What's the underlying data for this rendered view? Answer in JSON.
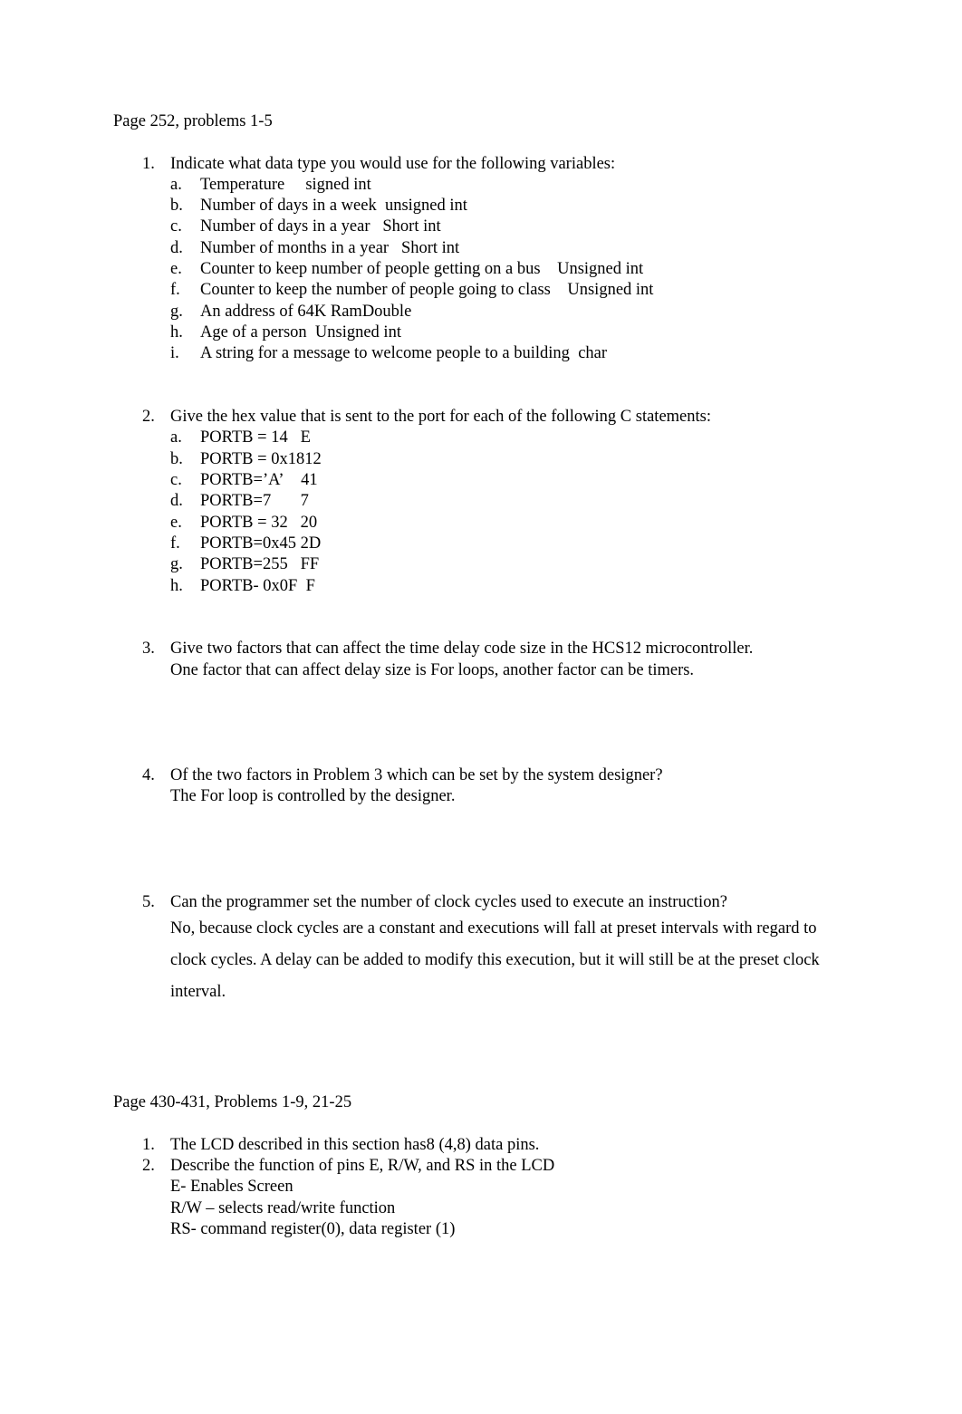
{
  "document": {
    "sections": [
      {
        "heading": "Page 252, problems 1-5",
        "items": [
          {
            "number": "1.",
            "text": "Indicate what data type you would use for the following variables:",
            "subitems": [
              {
                "marker": "a.",
                "text": "Temperature",
                "answer": "     signed int"
              },
              {
                "marker": "b.",
                "text": "Number of days in a week",
                "answer": "  unsigned int"
              },
              {
                "marker": "c.",
                "text": "Number of days in a year",
                "answer": "   Short int"
              },
              {
                "marker": "d.",
                "text": "Number of months in a year",
                "answer": "   Short int"
              },
              {
                "marker": "e.",
                "text": "Counter to keep number of people getting on a bus",
                "answer": "    Unsigned int"
              },
              {
                "marker": "f.",
                "text": "Counter to keep the number of people going to class",
                "answer": "    Unsigned int"
              },
              {
                "marker": "g.",
                "text": "An address of 64K Ram",
                "answer": "Double"
              },
              {
                "marker": "h.",
                "text": "Age of a person",
                "answer": "  Unsigned int"
              },
              {
                "marker": "i.",
                "text": "A string for a message to welcome people to a building",
                "answer": "  char"
              }
            ]
          },
          {
            "number": "2.",
            "text": "Give the hex value that is sent to the port for each of the following C statements:",
            "subitems": [
              {
                "marker": "a.",
                "text": "PORTB = 14",
                "answer": "   E"
              },
              {
                "marker": "b.",
                "text": "PORTB = 0x18",
                "answer": "12"
              },
              {
                "marker": "c.",
                "text": "PORTB=’A’",
                "answer": "    41"
              },
              {
                "marker": "d.",
                "text": "PORTB=7",
                "answer": "       7"
              },
              {
                "marker": "e.",
                "text": "PORTB = 32",
                "answer": "   20"
              },
              {
                "marker": "f.",
                "text": "PORTB=0x45",
                "answer": " 2D"
              },
              {
                "marker": "g.",
                "text": "PORTB=255",
                "answer": "   FF"
              },
              {
                "marker": "h.",
                "text": "PORTB- 0x0F",
                "answer": "  F"
              }
            ]
          },
          {
            "number": "3.",
            "text": "Give two factors that can affect the time delay code size in the HCS12 microcontroller.",
            "answer": "One factor that can affect delay size is For loops, another factor can be timers."
          },
          {
            "number": "4.",
            "text": "Of the two factors in Problem 3 which can be set by the system designer?",
            "answer": "The For loop is controlled by the designer."
          },
          {
            "number": "5.",
            "text": "Can the programmer set the number of clock cycles used to execute an instruction?",
            "answer": "No, because clock cycles are a constant and executions will fall at preset intervals with regard to clock cycles. A delay can be added to modify this execution, but it will still be at the preset clock interval."
          }
        ]
      },
      {
        "heading": "Page 430-431, Problems 1-9, 21-25",
        "items": [
          {
            "number": "1.",
            "text": "The LCD described in this section has",
            "answer_inline": "8",
            "text_after": " (4,8) data pins."
          },
          {
            "number": "2.",
            "text": "Describe the function of pins E, R/W, and RS in the LCD",
            "answer_lines": [
              "E- Enables Screen",
              "R/W – selects read/write function",
              "RS- command register(0), data register (1)"
            ]
          }
        ]
      }
    ]
  }
}
